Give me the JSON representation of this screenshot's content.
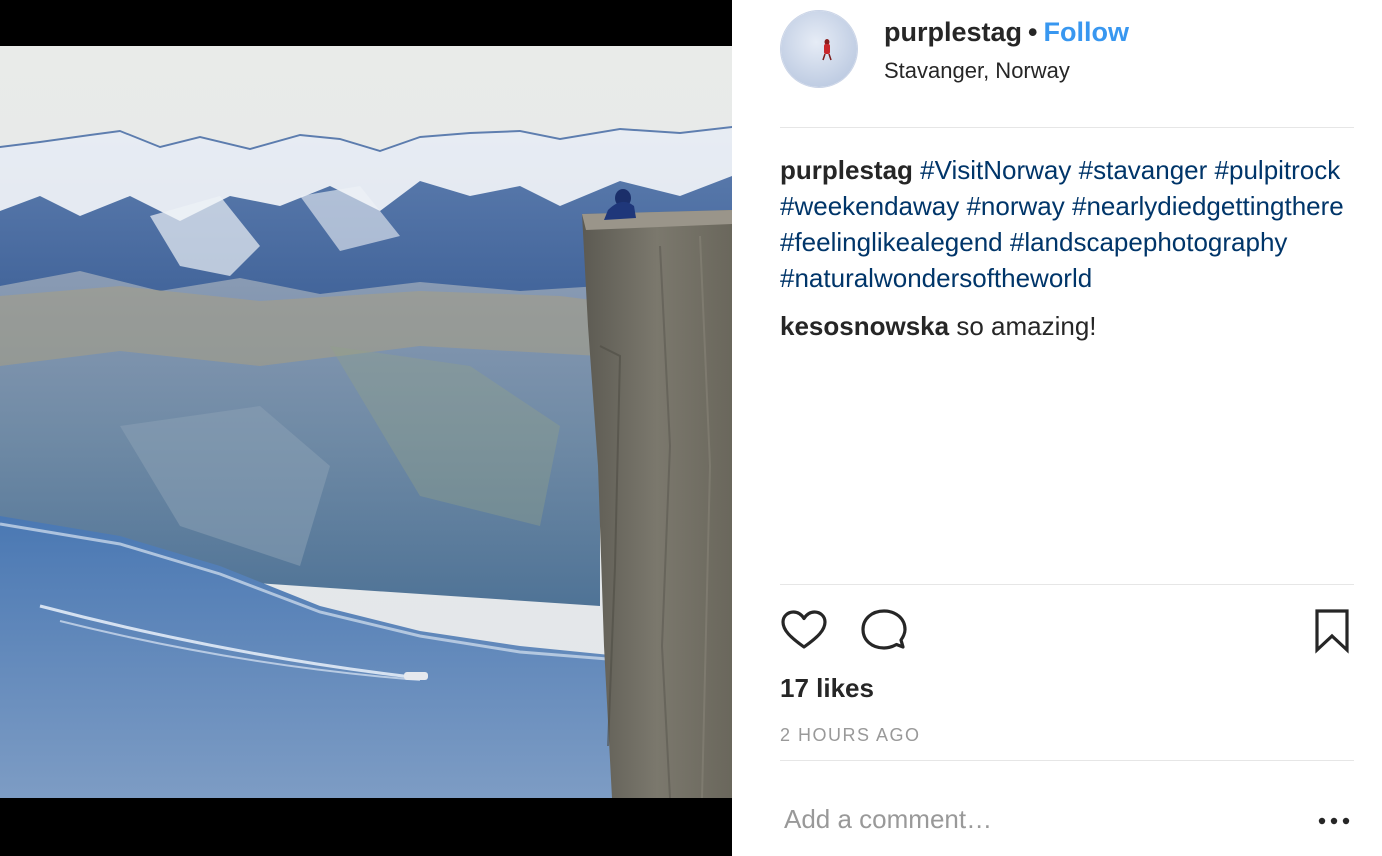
{
  "post": {
    "username": "purplestag",
    "separator": "•",
    "follow_label": "Follow",
    "location": "Stavanger, Norway",
    "caption": {
      "author": "purplestag",
      "hashtags": [
        "#VisitNorway",
        "#stavanger",
        "#pulpitrock",
        "#weekendaway",
        "#norway",
        "#nearlydiedgettingthere",
        "#feelinglikealegend",
        "#landscapephotography",
        "#naturalwondersoftheworld"
      ]
    },
    "comments": [
      {
        "author": "kesosnowska",
        "text": "so amazing!"
      }
    ],
    "likes": "17 likes",
    "timestamp": "2 HOURS AGO",
    "comment_placeholder": "Add a comment…"
  },
  "icons": {
    "like": "heart-icon",
    "comment": "comment-bubble-icon",
    "save": "bookmark-icon",
    "more": "more-options-icon"
  },
  "colors": {
    "link_blue": "#3897f0",
    "hashtag": "#003569",
    "muted": "#999999",
    "text": "#262626",
    "divider": "#e6e6e6"
  }
}
